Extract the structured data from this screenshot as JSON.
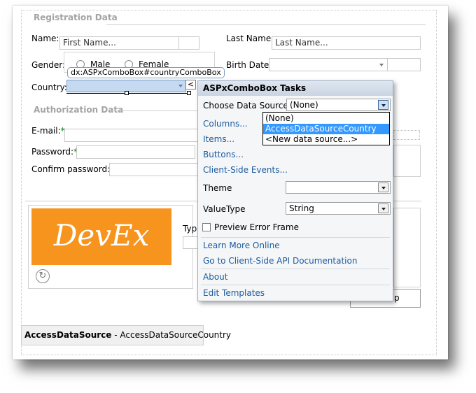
{
  "registration": {
    "title": "Registration Data",
    "name_label": "Name:",
    "name_placeholder": "First Name...",
    "last_name_label": "Last Name:",
    "last_name_placeholder": "Last Name...",
    "gender_label": "Gender:",
    "gender_options": [
      "Male",
      "Female"
    ],
    "birth_date_label": "Birth Date:",
    "country_label": "Country:",
    "country_tag": "dx:ASPxComboBox#countryComboBox"
  },
  "authorization": {
    "title": "Authorization Data",
    "email_label": "E-mail:",
    "password_label": "Password:",
    "confirm_label": "Confirm password:",
    "required_mark": "*"
  },
  "captcha": {
    "logo_text": "DevEx",
    "type_label": "Typ",
    "signup_fragment": "p"
  },
  "smart_tag": {
    "expander": "<"
  },
  "tasks_panel": {
    "title": "ASPxComboBox Tasks",
    "choose_label": "Choose Data Source:",
    "choose_value": "(None)",
    "datasource_options": [
      "(None)",
      "AccessDataSourceCountry",
      "<New data source...>"
    ],
    "selected_option_index": 1,
    "links_top": [
      "Columns...",
      "Items...",
      "Buttons...",
      "Client-Side Events..."
    ],
    "theme_label": "Theme",
    "theme_value": "",
    "valuetype_label": "ValueType",
    "valuetype_value": "String",
    "preview_label": "Preview Error Frame",
    "preview_checked": false,
    "links_learn": [
      "Learn More Online",
      "Go to Client-Side API Documentation"
    ],
    "about_link": "About",
    "edit_templates_link": "Edit Templates"
  },
  "datasource_bar": {
    "type": "AccessDataSource",
    "separator": " - ",
    "id": "AccessDataSourceCountry"
  },
  "colors": {
    "link": "#1c5a9e",
    "selection": "#3399ff",
    "logo_bg": "#f7941d",
    "required": "#008000"
  }
}
